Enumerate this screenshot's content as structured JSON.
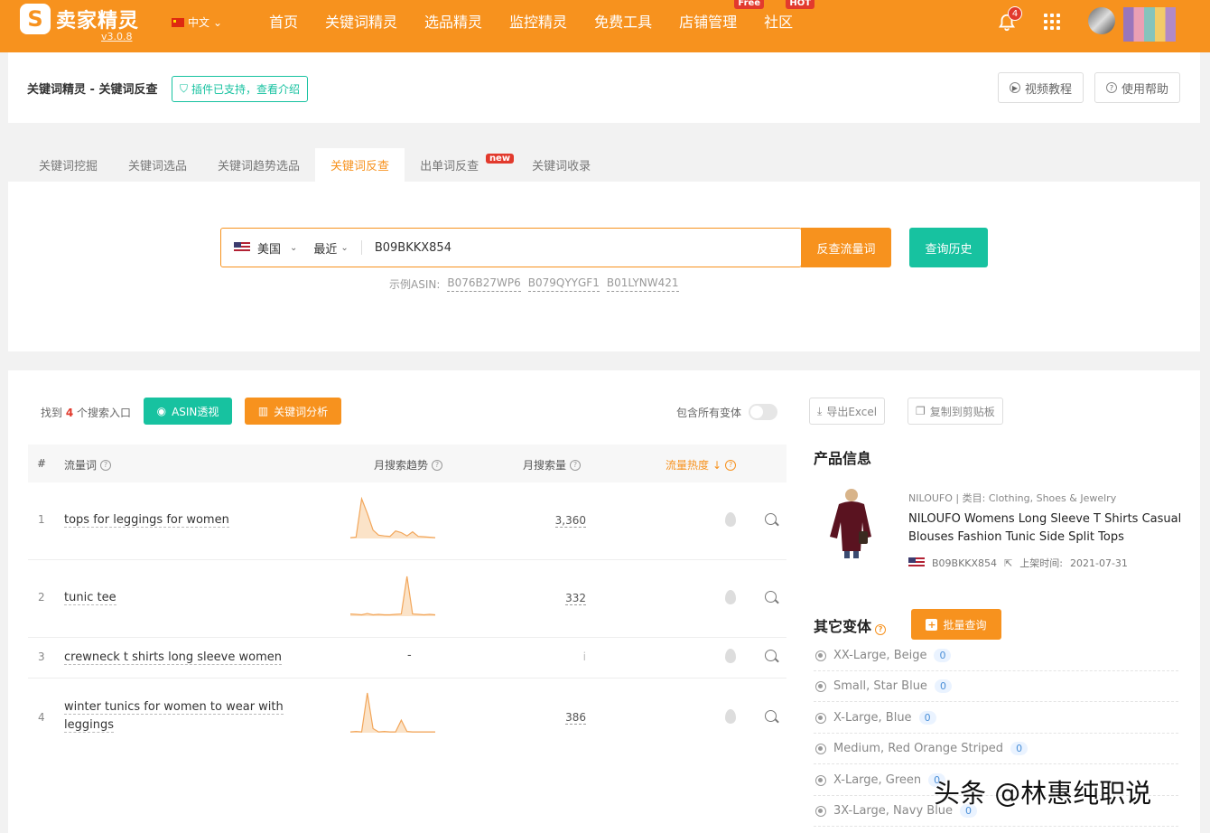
{
  "brand": {
    "name": "卖家精灵",
    "logo_letter": "S",
    "version": "v3.0.8"
  },
  "language": "中文",
  "nav": [
    {
      "label": "首页"
    },
    {
      "label": "关键词精灵"
    },
    {
      "label": "选品精灵"
    },
    {
      "label": "监控精灵"
    },
    {
      "label": "免费工具"
    },
    {
      "label": "店铺管理",
      "badge": "Free"
    },
    {
      "label": "社区",
      "badge": "HOT"
    }
  ],
  "notifications": {
    "count": "4"
  },
  "breadcrumb": "关键词精灵 - 关键词反查",
  "plugin_tag": "插件已支持，查看介绍",
  "help_buttons": {
    "video": "视频教程",
    "help": "使用帮助"
  },
  "tabs": [
    {
      "label": "关键词挖掘"
    },
    {
      "label": "关键词选品"
    },
    {
      "label": "关键词趋势选品"
    },
    {
      "label": "关键词反查",
      "active": true
    },
    {
      "label": "出单词反查",
      "badge": "new"
    },
    {
      "label": "关键词收录"
    }
  ],
  "search": {
    "market": "美国",
    "period": "最近",
    "value": "B09BKKX854",
    "submit_label": "反查流量词",
    "history_label": "查询历史",
    "examples_label": "示例ASIN:",
    "examples": [
      "B076B27WP6",
      "B079QYYGF1",
      "B01LYNW421"
    ]
  },
  "results": {
    "found_prefix": "找到",
    "found_count": "4",
    "found_suffix": "个搜索入口",
    "asin_btn": "ASIN透视",
    "kw_btn": "关键词分析",
    "variants_toggle": "包含所有变体",
    "columns": {
      "num": "#",
      "keyword": "流量词",
      "trend": "月搜索趋势",
      "volume": "月搜索量",
      "heat": "流量热度",
      "heat_sort": "↓"
    },
    "rows": [
      {
        "idx": "1",
        "keyword": "tops for leggings for women",
        "volume": "3,360",
        "trend": [
          2,
          3,
          95,
          60,
          20,
          8,
          6,
          5,
          18,
          14,
          6,
          16,
          5,
          4,
          3,
          2
        ]
      },
      {
        "idx": "2",
        "keyword": "tunic tee",
        "volume": "332",
        "trend": [
          5,
          4,
          3,
          6,
          3,
          4,
          3,
          3,
          4,
          5,
          90,
          5,
          4,
          3,
          4,
          3
        ]
      },
      {
        "idx": "3",
        "keyword": "crewneck t shirts long sleeve women",
        "volume_dash": "-",
        "volume": "i",
        "trend": []
      },
      {
        "idx": "4",
        "keyword": "winter tunics for women to wear with leggings",
        "volume": "386",
        "trend": [
          2,
          3,
          2,
          95,
          10,
          2,
          3,
          2,
          2,
          30,
          3,
          2,
          2,
          2,
          2,
          2
        ]
      }
    ]
  },
  "side": {
    "export_excel": "导出Excel",
    "copy_clipboard": "复制到剪贴板",
    "product_info_title": "产品信息",
    "product": {
      "brand": "NILOUFO",
      "category_label": "类目:",
      "category": "Clothing, Shoes & Jewelry",
      "title": "NILOUFO Womens Long Sleeve T Shirts Casual Blouses Fashion Tunic Side Split Tops",
      "asin": "B09BKKX854",
      "listed_label": "上架时间:",
      "listed_date": "2021-07-31"
    },
    "variants_title": "其它变体",
    "batch_btn": "批量查询",
    "variants": [
      {
        "name": "XX-Large, Beige",
        "count": "0"
      },
      {
        "name": "Small, Star Blue",
        "count": "0"
      },
      {
        "name": "X-Large, Blue",
        "count": "0"
      },
      {
        "name": "Medium, Red Orange Striped",
        "count": "0"
      },
      {
        "name": "X-Large, Green",
        "count": "0"
      },
      {
        "name": "3X-Large, Navy Blue",
        "count": "0"
      }
    ]
  },
  "watermark": "头条 @林惠纯职说",
  "colors": {
    "brand_orange": "#f7921e",
    "accent_green": "#17c2a0",
    "badge_red": "#e23a2d"
  }
}
